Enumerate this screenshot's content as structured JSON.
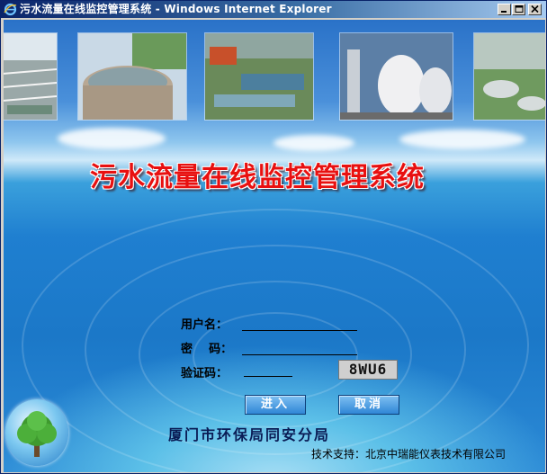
{
  "window": {
    "title": "污水流量在线监控管理系统 - Windows Internet Explorer"
  },
  "header": {
    "system_title": "污水流量在线监控管理系统"
  },
  "login": {
    "username_label": "用户名：",
    "password_label": "密    码：",
    "captcha_label": "验证码：",
    "captcha_code": "8WU6",
    "username_value": "",
    "password_value": "",
    "captcha_value": "",
    "login_button": "进入",
    "cancel_button": "取消"
  },
  "footer": {
    "organization": "厦门市环保局同安分局",
    "support": "技术支持：北京中瑞能仪表技术有限公司"
  },
  "colors": {
    "title_red": "#e81010",
    "titlebar_dark": "#0a246a",
    "button_blue": "#2f86d6"
  }
}
